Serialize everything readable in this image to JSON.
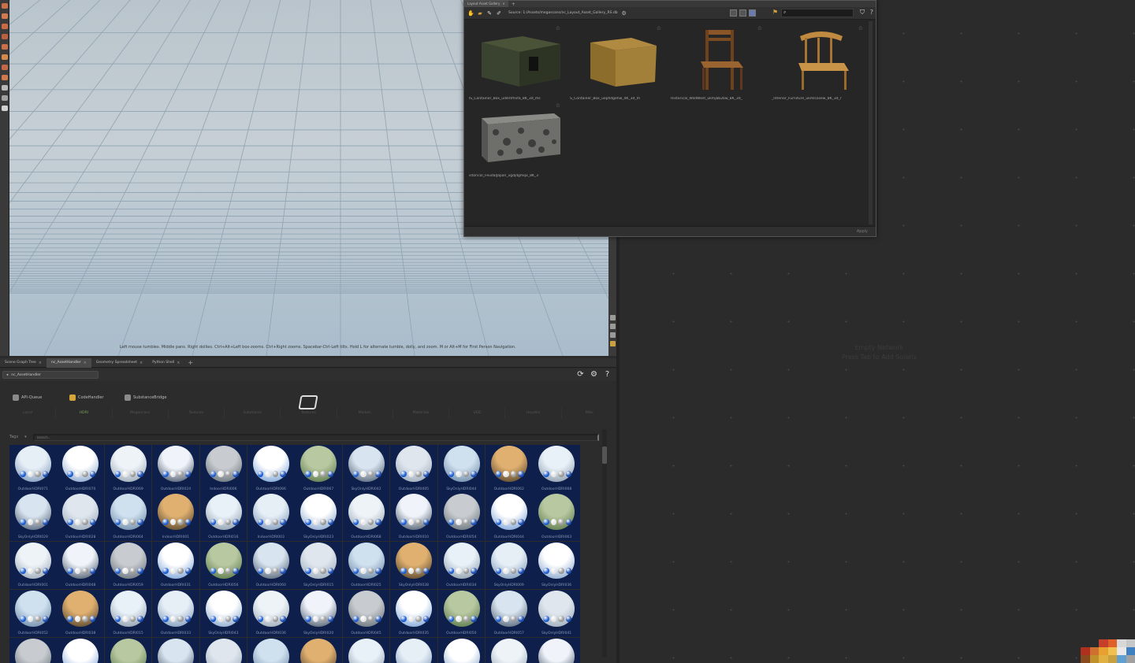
{
  "viewport": {
    "hint": "Left mouse tumbles. Middle pans. Right dollies. Ctrl+Alt+Left box-zooms. Ctrl+Right zooms. Spacebar-Ctrl-Left tilts. Hold L for alternate tumble, dolly, and zoom.    M or Alt+M for First Person Navigation."
  },
  "pane_tabs": [
    {
      "label": "Scene Graph Tree",
      "active": false
    },
    {
      "label": "nc_AssetHandler",
      "active": true
    },
    {
      "label": "Geometry Spreadsheet",
      "active": false
    },
    {
      "label": "Python Shell",
      "active": false
    }
  ],
  "path_bar": {
    "node": "nc_AssetHandler"
  },
  "asset_handler": {
    "buttons": [
      {
        "label": "API-Queue",
        "icon": "queue-icon",
        "color": "#9a9a9a"
      },
      {
        "label": "CodeHandler",
        "icon": "code-icon",
        "color": "#d4a63a"
      },
      {
        "label": "SubstanceBridge",
        "icon": "substance-icon",
        "color": "#9a9a9a"
      }
    ],
    "categories": [
      "Local",
      "HDRI",
      "Megascans",
      "Textures",
      "Substance",
      "Textures",
      "Models",
      "Materials",
      "USD",
      "Houdini",
      "Misc"
    ],
    "tags_label": "Tags",
    "search_placeholder": "Search...",
    "hdris": [
      "OutdoorHDRI071",
      "OutdoorHDRI070",
      "OutdoorHDRI069",
      "OutdoorHDRI024",
      "IndoorHDRI006",
      "OutdoorHDRI066",
      "OutdoorHDRI067",
      "SkyOnlyHDRI042",
      "OutdoorHDRI005",
      "SkyOnlyHDRI044",
      "OutdoorHDRI062",
      "OutdoorHDRI068",
      "SkyOnlyHDRI029",
      "OutdoorHDRI028",
      "OutdoorHDRI064",
      "IndoorHDRI001",
      "OutdoorHDRI016",
      "IndoorHDRI003",
      "SkyOnlyHDRI023",
      "OutdoorHDRI068",
      "OutdoorHDRI010",
      "OutdoorHDRI054",
      "OutdoorHDRI044",
      "OutdoorHDRI063",
      "OutdoorHDRI001",
      "OutdoorHDRI048",
      "OutdoorHDRI059",
      "OutdoorHDRI031",
      "OutdoorHDRI056",
      "OutdoorHDRI060",
      "SkyOnlyHDRI015",
      "OutdoorHDRI025",
      "SkyOnlyHDRI038",
      "OutdoorHDRI034",
      "SkyOnlyHDRI009",
      "SkyOnlyHDRI036",
      "OutdoorHDRI052",
      "OutdoorHDRI038",
      "OutdoorHDRI015",
      "OutdoorHDRI033",
      "SkyOnlyHDRI043",
      "OutdoorHDRI036",
      "SkyOnlyHDRI020",
      "OutdoorHDRI045",
      "OutdoorHDRI035",
      "OutdoorHDRI050",
      "OutdoorHDRI057",
      "SkyOnlyHDRI041",
      "",
      "",
      "",
      "",
      "",
      "",
      "",
      "",
      "",
      "",
      "",
      ""
    ]
  },
  "network": {
    "empty_line1": "Empty Network",
    "empty_line2": "Press Tab to Add Solaris"
  },
  "gallery": {
    "tab": "Layout Asset Gallery",
    "source": "Source: 1:/Assets/megascans/nc_Layout_Asset_Gallery_RS.db",
    "apply": "Apply",
    "items": [
      "lS_Container_Box_ud4mfhvfa_8K_3d_ms",
      "S_Container_Box_uephdgehw_4K_3d_m",
      "Historical_WildWest_ukmjbb2bw_8K_3d_",
      "_Interior_Furniture_ukmlcasew_8K_3d_r",
      "istorical_FeudalJapan_vgdjdgmqx_8K_3"
    ]
  },
  "colors": {
    "grid_bg": "#0d1f4a",
    "accent": "#6b7bb0"
  }
}
